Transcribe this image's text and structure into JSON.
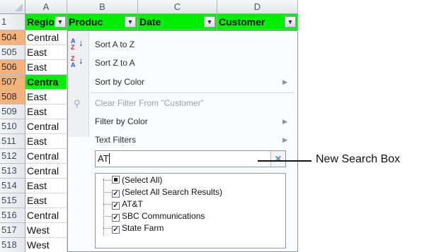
{
  "sheet": {
    "columns": [
      "A",
      "B",
      "C",
      "D"
    ],
    "header_row_number": "1",
    "headers": [
      "Region",
      "Produc",
      "Date",
      "Customer"
    ],
    "rows": [
      {
        "num": "504",
        "region": "Central",
        "hl": true
      },
      {
        "num": "505",
        "region": "East",
        "hl": false
      },
      {
        "num": "506",
        "region": "East",
        "hl": true
      },
      {
        "num": "507",
        "region": "Centra",
        "hl": true
      },
      {
        "num": "508",
        "region": "East",
        "hl": true
      },
      {
        "num": "509",
        "region": "East",
        "hl": false
      },
      {
        "num": "510",
        "region": "Central",
        "hl": false
      },
      {
        "num": "511",
        "region": "East",
        "hl": false
      },
      {
        "num": "512",
        "region": "Central",
        "hl": false
      },
      {
        "num": "513",
        "region": "Central",
        "hl": false
      },
      {
        "num": "514",
        "region": "East",
        "hl": false
      },
      {
        "num": "515",
        "region": "East",
        "hl": false
      },
      {
        "num": "516",
        "region": "Central",
        "hl": false
      },
      {
        "num": "517",
        "region": "West",
        "hl": false
      },
      {
        "num": "518",
        "region": "West",
        "hl": false
      }
    ],
    "colors": {
      "highlight_fill": "#00ee00",
      "row_hdr_hl": "#f5b27a"
    }
  },
  "menu": {
    "sort_az": "Sort A to Z",
    "sort_za": "Sort Z to A",
    "sort_by_color": "Sort by Color",
    "clear_filter": "Clear Filter From \"Customer\"",
    "filter_by_color": "Filter by Color",
    "text_filters": "Text Filters",
    "search_value": "AT",
    "search_clear": "✕",
    "list": [
      {
        "label": "(Select All)",
        "state": "partial"
      },
      {
        "label": "(Select All Search Results)",
        "state": "checked"
      },
      {
        "label": "AT&T",
        "state": "checked"
      },
      {
        "label": "SBC Communications",
        "state": "checked"
      },
      {
        "label": "State Farm",
        "state": "checked"
      }
    ]
  },
  "callout": {
    "label": "New Search Box"
  }
}
